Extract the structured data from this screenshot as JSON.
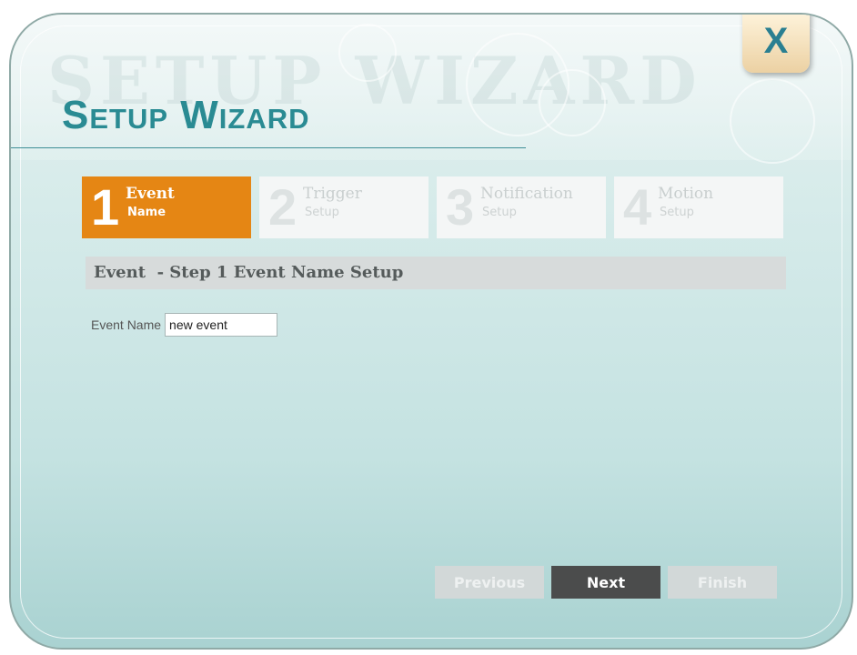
{
  "wizard": {
    "title": "Setup Wizard",
    "close_label": "X",
    "steps": [
      {
        "number": "1",
        "label": "Event",
        "sub": "Name",
        "active": true
      },
      {
        "number": "2",
        "label": "Trigger",
        "sub": "Setup",
        "active": false
      },
      {
        "number": "3",
        "label": "Notification",
        "sub": "Setup",
        "active": false
      },
      {
        "number": "4",
        "label": "Motion",
        "sub": "Setup",
        "active": false
      }
    ],
    "section_title": "Event  - Step 1 Event Name Setup",
    "event_name": {
      "label": "Event Name",
      "value": "new event"
    },
    "buttons": {
      "previous": "Previous",
      "next": "Next",
      "finish": "Finish"
    }
  },
  "colors": {
    "accent_orange": "#e58614",
    "title_teal": "#2a8b93",
    "primary_button": "#4b4c4c",
    "disabled_button": "#d2d8d8"
  }
}
